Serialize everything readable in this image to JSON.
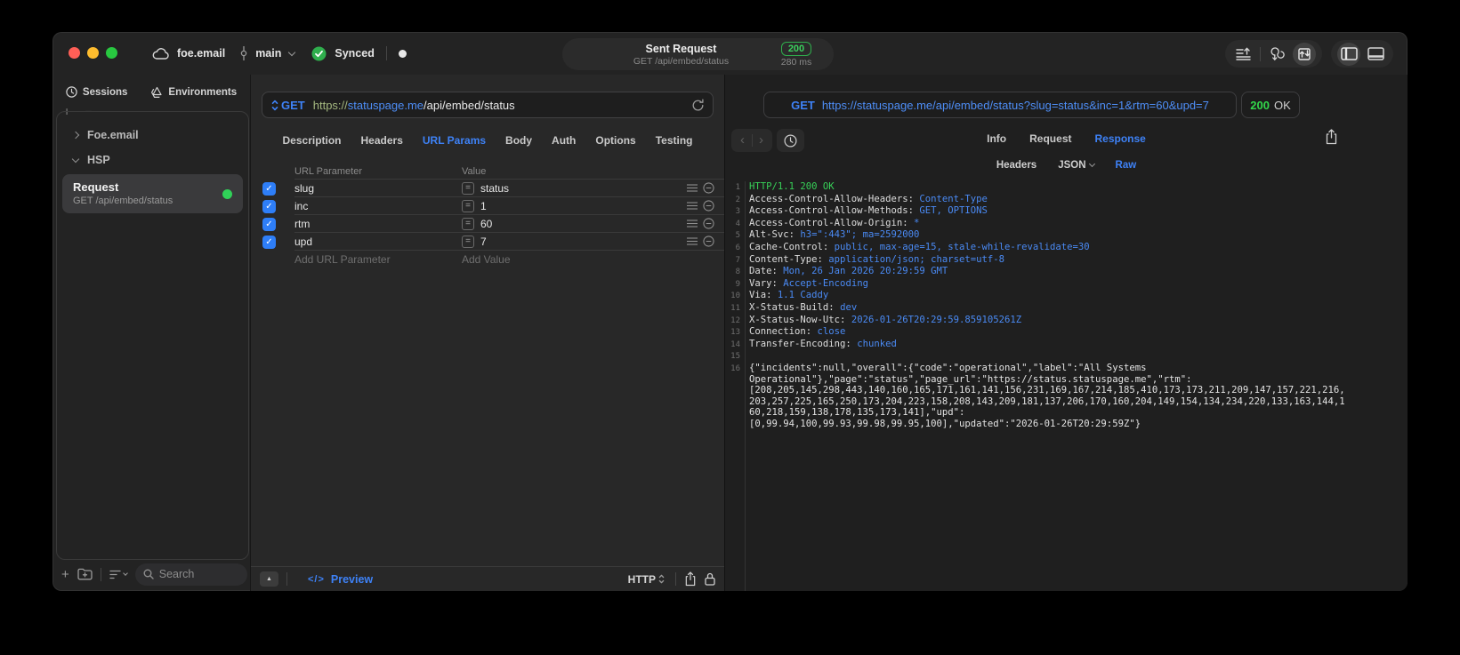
{
  "titlebar": {
    "project": "foe.email",
    "branch": "main",
    "sync_label": "Synced",
    "sent_request": {
      "title": "Sent Request",
      "subtitle": "GET /api/embed/status",
      "status_code": "200",
      "duration": "280 ms"
    }
  },
  "sidebar": {
    "tabs": [
      {
        "label": "Sessions"
      },
      {
        "label": "Environments"
      }
    ],
    "tree": [
      {
        "label": "Foe.email"
      },
      {
        "label": "HSP"
      }
    ],
    "request_item": {
      "title": "Request",
      "subtitle": "GET /api/embed/status"
    },
    "search_placeholder": "Search"
  },
  "request_editor": {
    "method": "GET",
    "url_scheme": "https://",
    "url_host": "statuspage.me",
    "url_path": "/api/embed/status",
    "tabs": [
      "Description",
      "Headers",
      "URL Params",
      "Body",
      "Auth",
      "Options",
      "Testing"
    ],
    "active_tab": "URL Params",
    "params": {
      "name_header": "URL Parameter",
      "value_header": "Value",
      "equals_glyph": "=",
      "rows": [
        {
          "name": "slug",
          "value": "status",
          "enabled": true
        },
        {
          "name": "inc",
          "value": "1",
          "enabled": true
        },
        {
          "name": "rtm",
          "value": "60",
          "enabled": true
        },
        {
          "name": "upd",
          "value": "7",
          "enabled": true
        }
      ],
      "add_name_label": "Add URL Parameter",
      "add_value_label": "Add Value"
    },
    "footer": {
      "code_glyph": "</>",
      "preview_label": "Preview",
      "mode_label": "HTTP"
    }
  },
  "response_viewer": {
    "method": "GET",
    "url": "https://statuspage.me/api/embed/status?slug=status&inc=1&rtm=60&upd=7",
    "status_code": "200",
    "status_text": "OK",
    "tabs": [
      "Info",
      "Request",
      "Response"
    ],
    "active_tab": "Response",
    "subtabs": [
      "Headers",
      "JSON",
      "Raw"
    ],
    "active_subtab": "Raw",
    "lines": [
      {
        "n": 1,
        "type": "status",
        "text": "HTTP/1.1 200 OK"
      },
      {
        "n": 2,
        "type": "header",
        "name": "Access-Control-Allow-Headers",
        "value": "Content-Type"
      },
      {
        "n": 3,
        "type": "header",
        "name": "Access-Control-Allow-Methods",
        "value": "GET, OPTIONS"
      },
      {
        "n": 4,
        "type": "header",
        "name": "Access-Control-Allow-Origin",
        "value": "*"
      },
      {
        "n": 5,
        "type": "header",
        "name": "Alt-Svc",
        "value": "h3=\":443\"; ma=2592000"
      },
      {
        "n": 6,
        "type": "header",
        "name": "Cache-Control",
        "value": "public, max-age=15, stale-while-revalidate=30"
      },
      {
        "n": 7,
        "type": "header",
        "name": "Content-Type",
        "value": "application/json; charset=utf-8"
      },
      {
        "n": 8,
        "type": "header",
        "name": "Date",
        "value": "Mon, 26 Jan 2026 20:29:59 GMT"
      },
      {
        "n": 9,
        "type": "header",
        "name": "Vary",
        "value": "Accept-Encoding"
      },
      {
        "n": 10,
        "type": "header",
        "name": "Via",
        "value": "1.1 Caddy"
      },
      {
        "n": 11,
        "type": "header",
        "name": "X-Status-Build",
        "value": "dev"
      },
      {
        "n": 12,
        "type": "header",
        "name": "X-Status-Now-Utc",
        "value": "2026-01-26T20:29:59.859105261Z"
      },
      {
        "n": 13,
        "type": "header",
        "name": "Connection",
        "value": "close"
      },
      {
        "n": 14,
        "type": "header",
        "name": "Transfer-Encoding",
        "value": "chunked"
      },
      {
        "n": 15,
        "type": "blank"
      },
      {
        "n": 16,
        "type": "body",
        "text_lines": [
          "{\"incidents\":null,\"overall\":{\"code\":\"operational\",\"label\":\"All Systems",
          "Operational\"},\"page\":\"status\",\"page_url\":\"https://status.statuspage.me\",\"rtm\":",
          "[208,205,145,298,443,140,160,165,171,161,141,156,231,169,167,214,185,410,173,173,211,209,147,157,221,216,",
          "203,257,225,165,250,173,204,223,158,208,143,209,181,137,206,170,160,204,149,154,134,234,220,133,163,144,1",
          "60,218,159,138,178,135,173,141],\"upd\":",
          "[0,99.94,100,99.93,99.98,99.95,100],\"updated\":\"2026-01-26T20:29:59Z\"}"
        ]
      }
    ]
  },
  "colors": {
    "accent_blue": "#3e82f7",
    "success_green": "#32d74b",
    "checkbox_blue": "#2e7ef7"
  }
}
